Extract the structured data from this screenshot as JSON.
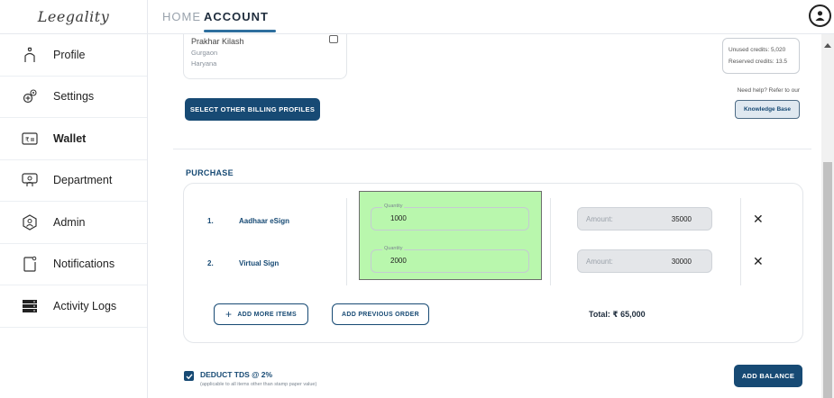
{
  "app": {
    "logo_text": "Leegality"
  },
  "sidebar": {
    "items": [
      {
        "label": "Profile",
        "icon": "person-icon"
      },
      {
        "label": "Settings",
        "icon": "gear-icon"
      },
      {
        "label": "Wallet",
        "icon": "wallet-icon",
        "active": true
      },
      {
        "label": "Department",
        "icon": "department-icon"
      },
      {
        "label": "Admin",
        "icon": "admin-icon"
      },
      {
        "label": "Notifications",
        "icon": "notification-icon"
      },
      {
        "label": "Activity Logs",
        "icon": "activity-log-icon"
      }
    ]
  },
  "topbar": {
    "tabs": [
      {
        "label": "HOME"
      },
      {
        "label": "ACCOUNT",
        "active": true
      }
    ]
  },
  "billing": {
    "address_name": "Prakhar Kilash",
    "city": "Gurgaon",
    "state": "Haryana",
    "select_button": "SELECT OTHER BILLING PROFILES"
  },
  "credits": {
    "unused": "Unused credits: 5,020",
    "reserved": "Reserved credits: 13.5"
  },
  "help": {
    "text": "Need help? Refer to our",
    "kb_button": "Knowledge Base"
  },
  "purchase": {
    "heading": "PURCHASE",
    "items": [
      {
        "num": "1.",
        "name": "Aadhaar eSign",
        "qty_label": "Quantity",
        "qty": "1000",
        "amount_label": "Amount:",
        "amount": "35000"
      },
      {
        "num": "2.",
        "name": "Virtual Sign",
        "qty_label": "Quantity",
        "qty": "2000",
        "amount_label": "Amount:",
        "amount": "30000"
      }
    ],
    "add_more": "ADD MORE ITEMS",
    "add_previous": "ADD PREVIOUS ORDER",
    "total": "Total: ₹ 65,000"
  },
  "tds": {
    "checked": true,
    "label": "DEDUCT TDS @ 2%",
    "note": "(applicable to all items other than stamp paper value)"
  },
  "actions": {
    "add_balance": "ADD BALANCE"
  },
  "colors": {
    "primary": "#174a74",
    "highlight": "#b9f7ad",
    "accent_underline": "#2e6f9e"
  }
}
